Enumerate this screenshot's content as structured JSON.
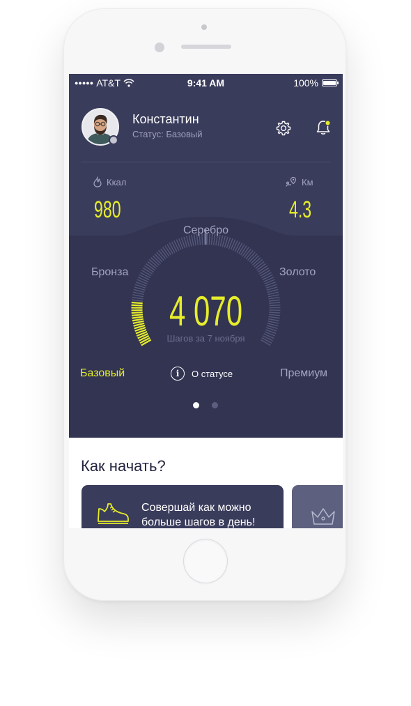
{
  "status_bar": {
    "carrier": "AT&T",
    "time": "9:41 AM",
    "battery": "100%",
    "signal_dots": "●●●●●"
  },
  "profile": {
    "name": "Константин",
    "status": "Статус: Базовый"
  },
  "stats": {
    "calories": {
      "label": "Ккал",
      "value": "980"
    },
    "distance": {
      "label": "Км",
      "value": "4.3"
    }
  },
  "levels": {
    "top": "Серебро",
    "left": "Бронза",
    "right": "Золото",
    "bottom_left": "Базовый",
    "bottom_right": "Премиум"
  },
  "steps": {
    "value": "4 070",
    "caption": "Шагов за 7 ноября",
    "progress": 0.15
  },
  "about_button": "О статусе",
  "pager": {
    "count": 2,
    "active": 0
  },
  "section": {
    "title": "Как начать?"
  },
  "cards": [
    {
      "text_line1": "Совершай как можно",
      "text_line2": "больше шагов в день!",
      "icon": "sneaker-icon"
    },
    {
      "icon": "crown-icon"
    }
  ],
  "colors": {
    "accent": "#e6ed2a",
    "background_dark": "#3a3c5c",
    "muted": "#a3a4c0"
  }
}
